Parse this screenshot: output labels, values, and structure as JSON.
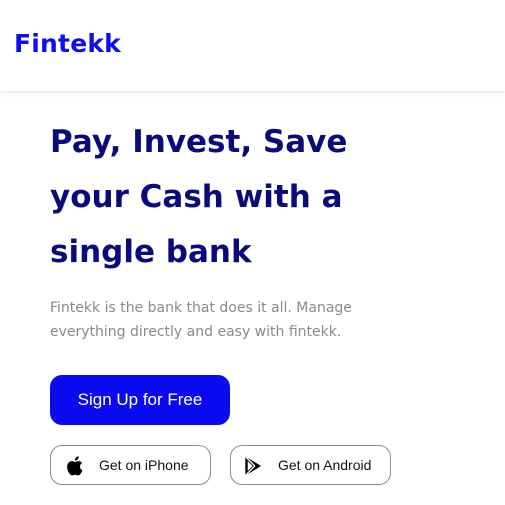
{
  "header": {
    "logo": "Fintekk"
  },
  "hero": {
    "title_lines": [
      "Pay, Invest, Save",
      "your Cash with a",
      "single bank"
    ],
    "description_lines": [
      "Fintekk is the bank that does it all. Manage",
      "everything directly and easy with fintekk."
    ],
    "cta_label": "Sign Up for Free"
  },
  "stores": {
    "iphone": {
      "label": "Get on iPhone",
      "icon": "apple-icon"
    },
    "android": {
      "label": "Get on Android",
      "icon": "google-play-icon"
    }
  },
  "colors": {
    "brand": "#0d0df2",
    "heading": "#0a0a7a",
    "body_text": "#8a8a8a",
    "cta_background": "#0a0af0"
  }
}
